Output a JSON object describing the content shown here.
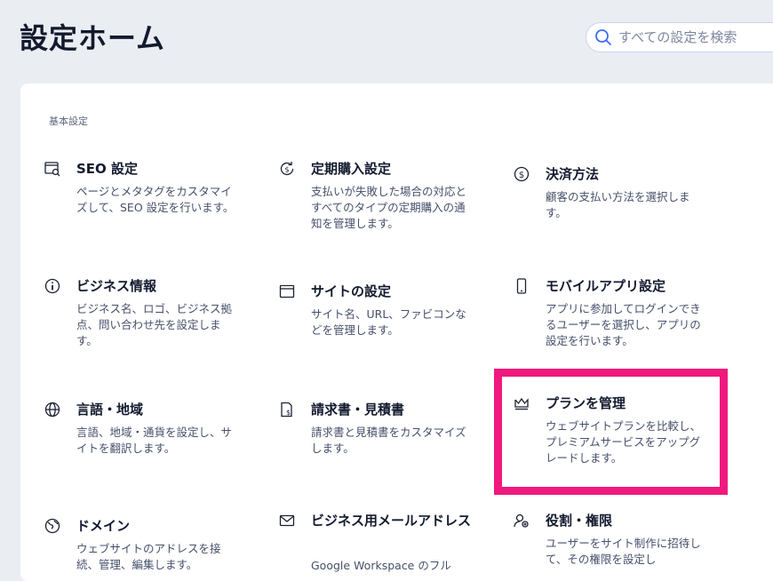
{
  "header": {
    "title": "設定ホーム",
    "search_placeholder": "すべての設定を検索"
  },
  "section": {
    "label": "基本設定"
  },
  "items": [
    {
      "title": "SEO 設定",
      "desc": "ページとメタタグをカスタマイズして、SEO 設定を行います。",
      "icon": "seo-icon"
    },
    {
      "title": "定期購入設定",
      "desc": "支払いが失敗した場合の対応とすべてのタイプの定期購入の通知を管理します。",
      "icon": "subscription-icon"
    },
    {
      "title": "決済方法",
      "desc": "顧客の支払い方法を選択します。",
      "icon": "dollar-icon"
    },
    {
      "title": "ビジネス情報",
      "desc": "ビジネス名、ロゴ、ビジネス拠点、問い合わせ先を設定します。",
      "icon": "info-icon"
    },
    {
      "title": "サイトの設定",
      "desc": "サイト名、URL、ファビコンなどを管理します。",
      "icon": "browser-window-icon"
    },
    {
      "title": "モバイルアプリ設定",
      "desc": "アプリに参加してログインできるユーザーを選択し、アプリの設定を行います。",
      "icon": "mobile-icon"
    },
    {
      "title": "言語・地域",
      "desc": "言語、地域・通貨を設定し、サイトを翻訳します。",
      "icon": "globe-icon"
    },
    {
      "title": "請求書・見積書",
      "desc": "請求書と見積書をカスタマイズします。",
      "icon": "invoice-icon"
    },
    {
      "title": "プランを管理",
      "desc": "ウェブサイトプランを比較し、プレミアムサービスをアップグレードします。",
      "icon": "crown-icon"
    },
    {
      "title": "ドメイン",
      "desc": "ウェブサイトのアドレスを接続、管理、編集します。",
      "icon": "domain-icon"
    },
    {
      "title": "ビジネス用メールアドレス",
      "desc": "Google Workspace のフル",
      "icon": "mail-icon"
    },
    {
      "title": "役割・権限",
      "desc": "ユーザーをサイト制作に招待して、その権限を設定し",
      "icon": "user-role-icon"
    }
  ],
  "colors": {
    "background": "#eaedf2",
    "panel": "#ffffff",
    "highlight": "#f0197d",
    "search_icon": "#3b6cf2"
  }
}
